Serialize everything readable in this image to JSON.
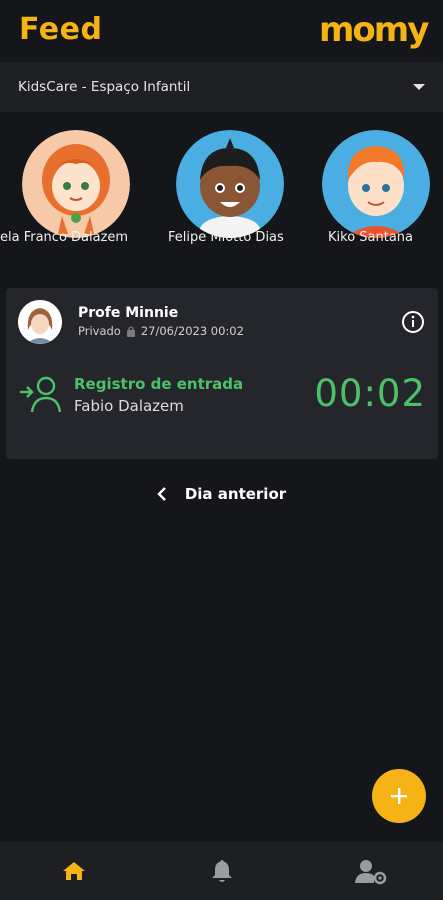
{
  "header": {
    "title": "Feed",
    "logo_text": "momy"
  },
  "selector": {
    "value": "KidsCare - Espaço Infantil"
  },
  "children": [
    {
      "name": "ela Franco Dalazem"
    },
    {
      "name": "Felipe Miotto Dias"
    },
    {
      "name": "Kiko Santana"
    }
  ],
  "post": {
    "author": "Profe Minnie",
    "visibility": "Privado",
    "timestamp": "27/06/2023 00:02",
    "event_title": "Registro de entrada",
    "event_person": "Fabio Dalazem",
    "event_time": "00:02"
  },
  "navigation": {
    "previous_day": "Dia anterior"
  },
  "colors": {
    "accent": "#f5b316",
    "success": "#4cc267",
    "background": "#151619"
  },
  "icons": [
    "plus-icon",
    "home-icon",
    "bell-icon",
    "user-settings-icon",
    "info-icon",
    "lock-icon",
    "chevron-left-icon",
    "user-entry-icon"
  ]
}
